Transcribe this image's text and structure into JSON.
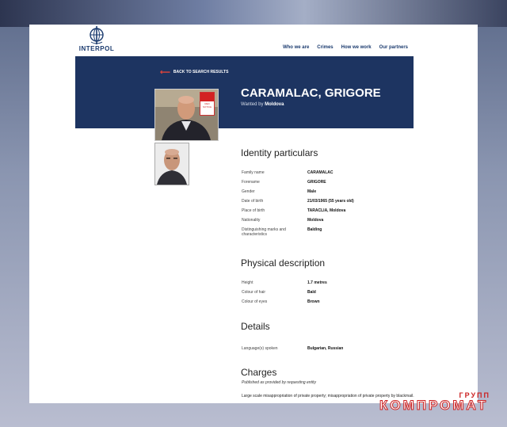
{
  "site": {
    "logo_text": "INTERPOL"
  },
  "nav": {
    "items": [
      "Who we are",
      "Crimes",
      "How we work",
      "Our partners"
    ]
  },
  "banner": {
    "back_label": "BACK TO SEARCH RESULTS",
    "name": "CARAMALAC, GRIGORE",
    "wanted_prefix": "Wanted by",
    "wanted_country": "Moldova",
    "notice_lines": [
      "RED",
      "NOTICE"
    ]
  },
  "identity": {
    "heading": "Identity particulars",
    "rows": [
      {
        "label": "Family name",
        "value": "CARAMALAC"
      },
      {
        "label": "Forename",
        "value": "GRIGORE"
      },
      {
        "label": "Gender",
        "value": "Male"
      },
      {
        "label": "Date of birth",
        "value": "21/03/1965 (55 years old)"
      },
      {
        "label": "Place of birth",
        "value": "TARACLIA, Moldova"
      },
      {
        "label": "Nationality",
        "value": "Moldova"
      },
      {
        "label": "Distinguishing marks and characteristics",
        "value": "Balding"
      }
    ]
  },
  "physical": {
    "heading": "Physical description",
    "rows": [
      {
        "label": "Height",
        "value": "1.7 metres"
      },
      {
        "label": "Colour of hair",
        "value": "Bald"
      },
      {
        "label": "Colour of eyes",
        "value": "Brown"
      }
    ]
  },
  "details": {
    "heading": "Details",
    "rows": [
      {
        "label": "Language(s) spoken",
        "value": "Bulgarian, Russian"
      }
    ]
  },
  "charges": {
    "heading": "Charges",
    "subtitle": "Published as provided by requesting entity",
    "text": "Large scale misappropriation of private property; misappropriation of private property by blackmail."
  },
  "watermark": {
    "small": "ГРУПП",
    "big": "КОМПРОМАТ"
  },
  "colors": {
    "banner": "#1d3461",
    "accent_red": "#d32222",
    "nav_text": "#1a3a6e"
  }
}
